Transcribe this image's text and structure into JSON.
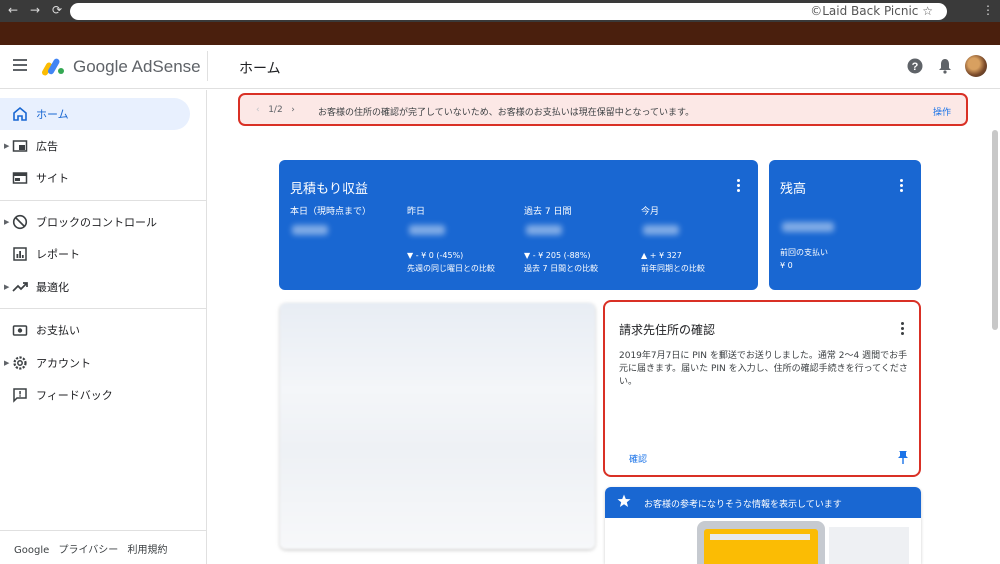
{
  "browser": {
    "back": "←",
    "forward": "→",
    "reload": "⟳",
    "watermark": "©Laid Back Picnic",
    "bookmark": "☆",
    "menu": "⋮"
  },
  "header": {
    "brand": "Google AdSense",
    "page_title": "ホーム",
    "icons": [
      "menu-icon",
      "adsense-logo-icon",
      "help-icon",
      "bell-icon",
      "avatar"
    ]
  },
  "sidebar": {
    "items": [
      {
        "label": "ホーム",
        "icon": "home-icon",
        "active": true,
        "caret": false
      },
      {
        "label": "広告",
        "icon": "ads-icon",
        "active": false,
        "caret": true
      },
      {
        "label": "サイト",
        "icon": "sites-icon",
        "active": false,
        "caret": false
      },
      {
        "label": "ブロックのコントロール",
        "icon": "block-icon",
        "active": false,
        "caret": true
      },
      {
        "label": "レポート",
        "icon": "reports-icon",
        "active": false,
        "caret": false
      },
      {
        "label": "最適化",
        "icon": "trending-icon",
        "active": false,
        "caret": true
      },
      {
        "label": "お支払い",
        "icon": "payments-icon",
        "active": false,
        "caret": false
      },
      {
        "label": "アカウント",
        "icon": "settings-icon",
        "active": false,
        "caret": true
      },
      {
        "label": "フィードバック",
        "icon": "feedback-icon",
        "active": false,
        "caret": false
      }
    ],
    "footer": {
      "google": "Google",
      "privacy": "プライバシー",
      "terms": "利用規約"
    }
  },
  "alert": {
    "pager": "1/2",
    "message": "お客様の住所の確認が完了していないため、お客様のお支払いは現在保留中となっています。",
    "action": "操作"
  },
  "earnings": {
    "title": "見積もり収益",
    "metrics": [
      {
        "label": "本日（現時点まで）",
        "change": "",
        "compare": ""
      },
      {
        "label": "昨日",
        "change": "▼ - ¥ 0 (-45%)",
        "compare": "先週の同じ曜日との比較"
      },
      {
        "label": "過去 7 日間",
        "change": "▼ - ¥ 205 (-88%)",
        "compare": "過去 7 日間との比較"
      },
      {
        "label": "今月",
        "change": "▲ + ¥ 327",
        "compare": "前年同期との比較"
      }
    ]
  },
  "balance": {
    "title": "残高",
    "last_payment_label": "前回の支払い",
    "last_payment_value": "¥ 0"
  },
  "verify_card": {
    "title": "請求先住所の確認",
    "body": "2019年7月7日に PIN を郵送でお送りしました。通常 2〜4 週間でお手元に届きます。届いた PIN を入力し、住所の確認手続きを行ってください。",
    "link": "確認"
  },
  "tips_card": {
    "title": "お客様の参考になりそうな情報を表示しています"
  },
  "colors": {
    "primary_blue": "#1967d2",
    "alert_red": "#d93025",
    "alert_bg": "#fce8e6",
    "chrome_brown": "#4a1f0d"
  }
}
